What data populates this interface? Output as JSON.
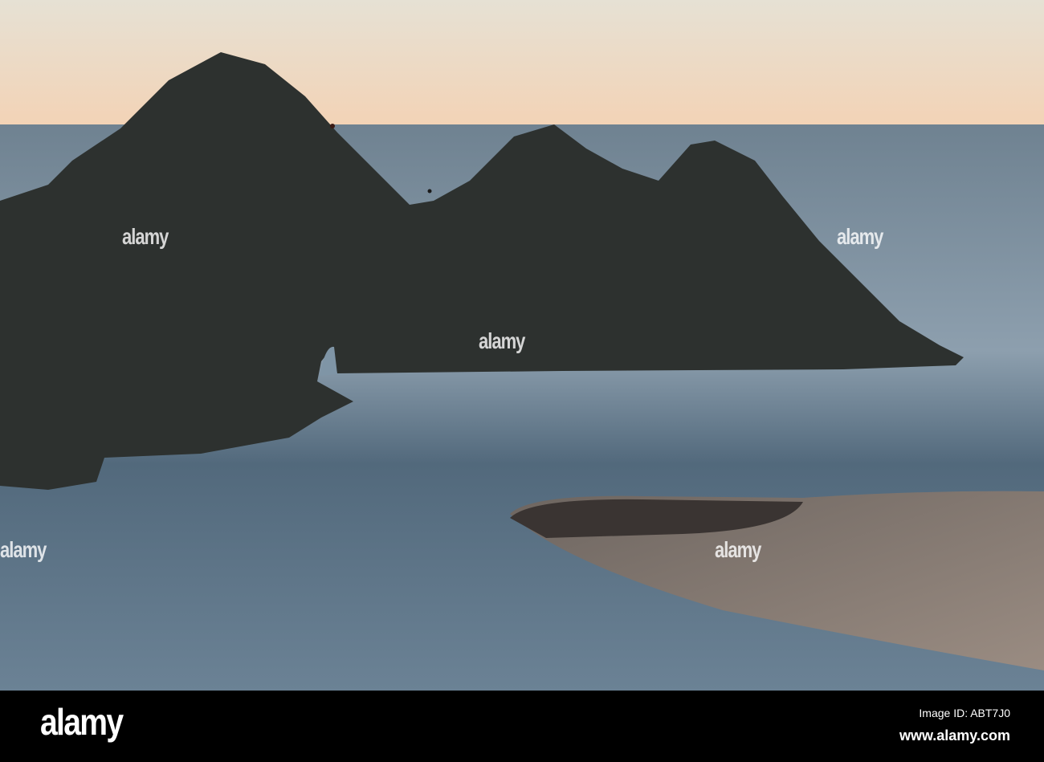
{
  "watermark": {
    "text": "alamy"
  },
  "footer": {
    "logo": "alamy",
    "image_id": "Image ID: ABT7J0",
    "url": "www.alamy.com"
  },
  "colors": {
    "sky_top": "#e9e3d6",
    "sky_horizon": "#f2d2b4",
    "sea": "#5d7384",
    "rock": "#2b2f2d",
    "sand": "#8a7f76"
  }
}
